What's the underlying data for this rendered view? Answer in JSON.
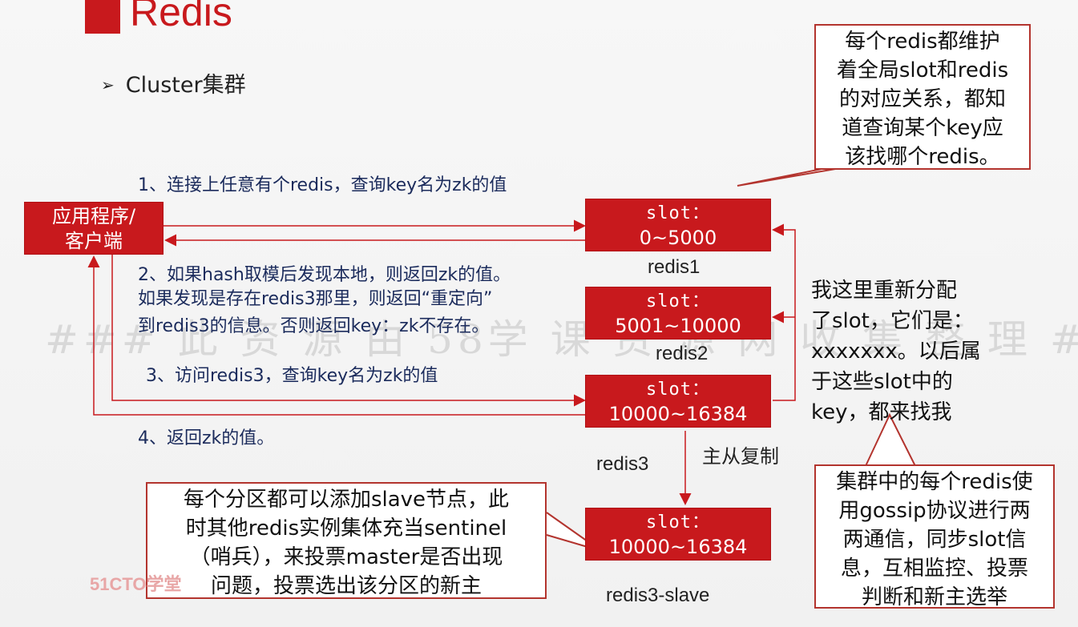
{
  "header": {
    "title": "Redis"
  },
  "bullet": {
    "marker": "➢",
    "text": "Cluster集群"
  },
  "client": {
    "line1": "应用程序/",
    "line2": "客户端"
  },
  "steps": {
    "s1": "1、连接上任意有个redis，查询key名为zk的值",
    "s2_l1": "2、如果hash取模后发现本地，则返回zk的值。",
    "s2_l2": "如果发现是存在redis3那里，则返回“重定向”",
    "s2_l3": "到redis3的信息。否则返回key：zk不存在。",
    "s3": "3、访问redis3，查询key名为zk的值",
    "s4": "4、返回zk的值。"
  },
  "nodes": [
    {
      "slot": "slot：",
      "range": "0~5000",
      "name": "redis1"
    },
    {
      "slot": "slot：",
      "range": "5001~10000",
      "name": "redis2"
    },
    {
      "slot": "slot：",
      "range": "10000~16384",
      "name": "redis3"
    },
    {
      "slot": "slot：",
      "range": "10000~16384",
      "name": "redis3-slave"
    }
  ],
  "replication_label": "主从复制",
  "callouts": {
    "top_right": [
      "每个redis都维护",
      "着全局slot和redis",
      "的对应关系，都知",
      "道查询某个key应",
      "该找哪个redis。"
    ],
    "middle_right": [
      "我这里重新分配",
      "了slot，它们是：",
      "xxxxxxx。以后属",
      "于这些slot中的",
      "key，都来找我"
    ],
    "bottom_right": [
      "集群中的每个redis使",
      "用gossip协议进行两",
      "两通信，同步slot信",
      "息，互相监控、投票",
      "判断和新主选举"
    ],
    "bottom_left": [
      "每个分区都可以添加slave节点，此",
      "时其他redis实例集体充当sentinel",
      "（哨兵），来投票master是否出现",
      "问题，投票选出该分区的新主"
    ]
  },
  "watermark": "###  此 资 源 由  58学 课 资 源 网  收 集 整 理 ###",
  "logo": "51CTO学堂",
  "colors": {
    "accent": "#c8191d",
    "callout_border": "#b3342e",
    "step_text": "#1b2b5c"
  }
}
